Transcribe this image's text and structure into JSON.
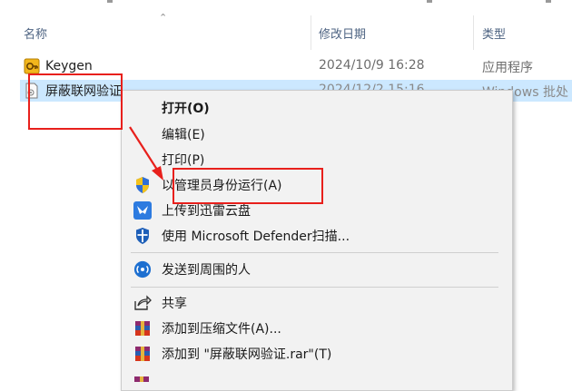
{
  "columns": {
    "name": "名称",
    "modified": "修改日期",
    "type": "类型"
  },
  "files": [
    {
      "name": "Keygen",
      "date": "2024/10/9 16:28",
      "type": "应用程序",
      "icon": "keygen-app-icon",
      "selected": false
    },
    {
      "name": "屏蔽联网验证",
      "date": "2024/12/2 15:16",
      "type": "Windows 批处",
      "icon": "batch-file-icon",
      "selected": true
    }
  ],
  "context_menu": {
    "items": [
      {
        "label": "打开(O)",
        "bold": true,
        "icon": ""
      },
      {
        "label": "编辑(E)",
        "bold": false,
        "icon": ""
      },
      {
        "label": "打印(P)",
        "bold": false,
        "icon": ""
      },
      {
        "label": "以管理员身份运行(A)",
        "bold": false,
        "icon": "uac-shield-icon"
      },
      {
        "label": "上传到迅雷云盘",
        "bold": false,
        "icon": "xunlei-cloud-icon"
      },
      {
        "label": "使用 Microsoft Defender扫描...",
        "bold": false,
        "icon": "defender-shield-icon"
      },
      {
        "label": "发送到周围的人",
        "bold": false,
        "icon": "nearby-share-icon"
      },
      {
        "label": "共享",
        "bold": false,
        "icon": "share-icon"
      },
      {
        "label": "添加到压缩文件(A)...",
        "bold": false,
        "icon": "winrar-icon"
      },
      {
        "label": "添加到 \"屏蔽联网验证.rar\"(T)",
        "bold": false,
        "icon": "winrar-icon"
      }
    ]
  },
  "colors": {
    "selection": "#cce8ff",
    "annotation": "#e8201c",
    "menu_bg": "#f2f2f2",
    "header_text": "#4d6382"
  }
}
